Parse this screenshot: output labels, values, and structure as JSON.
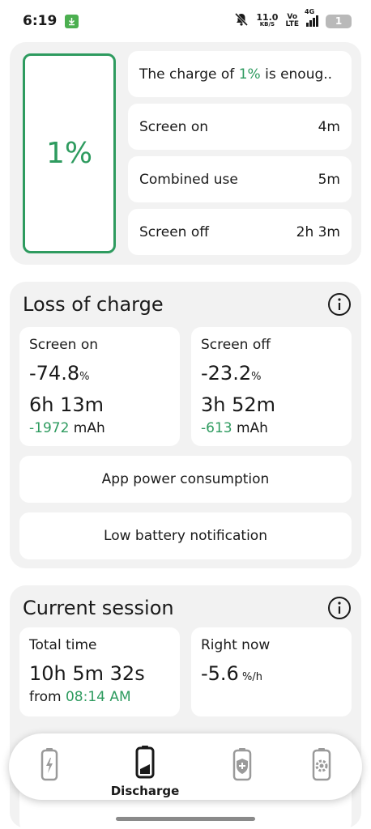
{
  "status_bar": {
    "time": "6:19",
    "speed_value": "11.0",
    "speed_unit": "KB/S",
    "volte_top": "Vo",
    "volte_bottom": "LTE",
    "network": "4G",
    "battery_level": "1"
  },
  "summary": {
    "percent": "1%",
    "message_prefix": "The charge of ",
    "message_highlight": "1%",
    "message_suffix": " is enoug..",
    "rows": [
      {
        "label": "Screen on",
        "value": "4m"
      },
      {
        "label": "Combined use",
        "value": "5m"
      },
      {
        "label": "Screen off",
        "value": "2h 3m"
      }
    ]
  },
  "loss": {
    "title": "Loss of charge",
    "screen_on": {
      "label": "Screen on",
      "percent": "-74.8",
      "unit": "%",
      "time": "6h 13m",
      "mah_value": "-1972",
      "mah_unit": " mAh"
    },
    "screen_off": {
      "label": "Screen off",
      "percent": "-23.2",
      "unit": "%",
      "time": "3h 52m",
      "mah_value": "-613",
      "mah_unit": " mAh"
    },
    "app_power_label": "App power consumption",
    "low_battery_label": "Low battery notification"
  },
  "session": {
    "title": "Current session",
    "total_label": "Total time",
    "total_value": "10h 5m 32s",
    "from_label": "from ",
    "from_time": "08:14 AM",
    "now_label": "Right now",
    "now_value": "-5.6",
    "now_unit": " %/h"
  },
  "nav": {
    "items": [
      {
        "icon": "charging-battery-icon",
        "label": ""
      },
      {
        "icon": "discharge-battery-icon",
        "label": "Discharge"
      },
      {
        "icon": "battery-health-icon",
        "label": ""
      },
      {
        "icon": "battery-settings-icon",
        "label": ""
      }
    ]
  },
  "colors": {
    "accent": "#2e9b5f",
    "card_background": "#f2f2f2"
  }
}
